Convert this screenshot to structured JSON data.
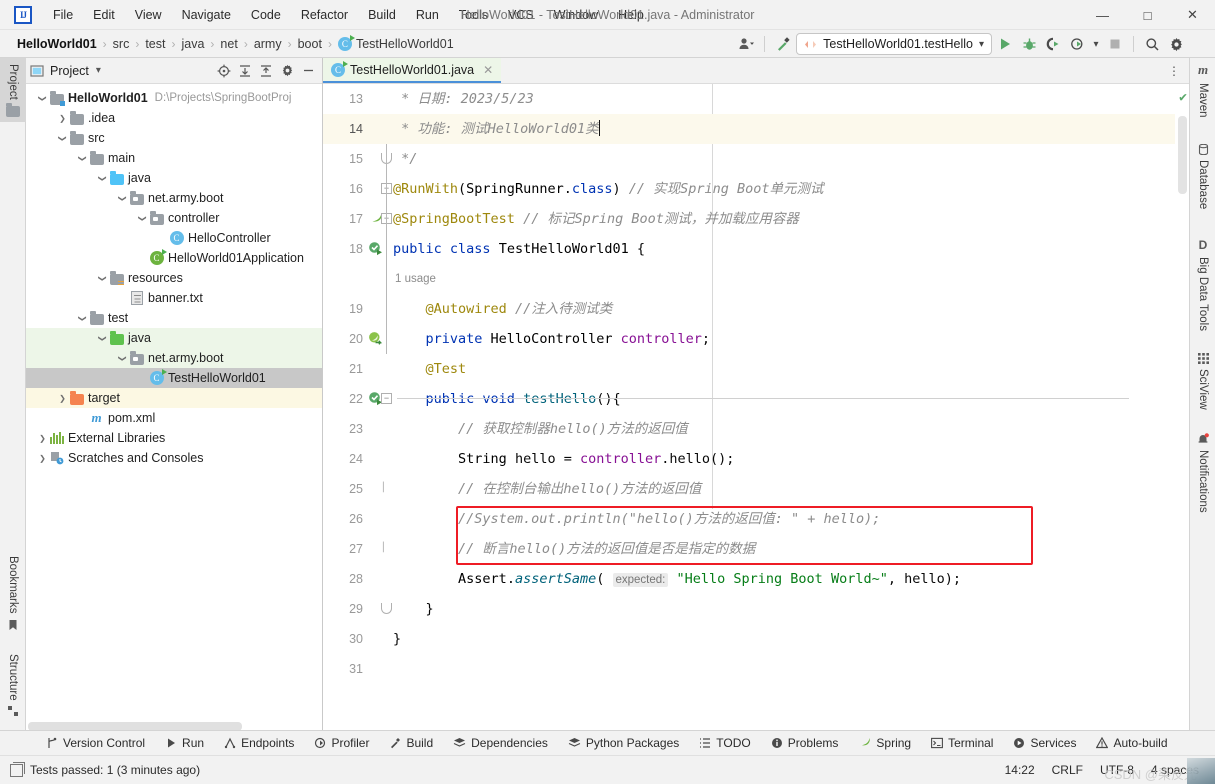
{
  "window": {
    "title": "HelloWorld01 - TestHelloWorld01.java - Administrator",
    "minimize": "—",
    "maximize": "□",
    "close": "✕",
    "logo": "IJ"
  },
  "menubar": {
    "items": [
      "File",
      "Edit",
      "View",
      "Navigate",
      "Code",
      "Refactor",
      "Build",
      "Run",
      "Tools",
      "VCS",
      "Window",
      "Help"
    ]
  },
  "breadcrumb": {
    "items": [
      "HelloWorld01",
      "src",
      "test",
      "java",
      "net",
      "army",
      "boot",
      "TestHelloWorld01"
    ],
    "separator": "›"
  },
  "toolbar": {
    "run_config": "TestHelloWorld01.testHello",
    "dropdown_caret": "▾",
    "icons": [
      "profile-icon",
      "build-hammer-icon",
      "run-icon",
      "debug-icon",
      "run-coverage-icon",
      "profile-run-icon",
      "stop-icon",
      "search-icon",
      "settings-icon",
      "ai-assistant-icon"
    ]
  },
  "left_tool_strip": {
    "tabs": [
      {
        "label": "Project",
        "icon": "folder-icon",
        "active": true
      },
      {
        "label": "Bookmarks",
        "icon": "bookmark-icon",
        "active": false
      },
      {
        "label": "Structure",
        "icon": "structure-icon",
        "active": false
      }
    ]
  },
  "right_tool_strip": {
    "tabs": [
      {
        "label": "Maven",
        "icon": "maven-icon"
      },
      {
        "label": "Database",
        "icon": "database-icon"
      },
      {
        "label": "Big Data Tools",
        "icon": "bigdata-icon"
      },
      {
        "label": "SciView",
        "icon": "sciview-icon"
      },
      {
        "label": "Notifications",
        "icon": "bell-icon"
      }
    ]
  },
  "project_panel": {
    "title": "Project",
    "title_caret": "▾",
    "header_icons": [
      "locate-icon",
      "expand-all-icon",
      "collapse-all-icon",
      "settings-icon",
      "hide-icon"
    ],
    "tree": [
      {
        "depth": 0,
        "arrow": "down",
        "icon": "module-folder-icon",
        "label": "HelloWorld01",
        "bold": true,
        "path": "D:\\Projects\\SpringBootProj",
        "state": "normal"
      },
      {
        "depth": 1,
        "arrow": "right",
        "icon": "folder-icon",
        "label": ".idea",
        "bold": false,
        "path": "",
        "state": "normal"
      },
      {
        "depth": 1,
        "arrow": "down",
        "icon": "folder-icon",
        "label": "src",
        "bold": false,
        "path": "",
        "state": "normal"
      },
      {
        "depth": 2,
        "arrow": "down",
        "icon": "folder-icon",
        "label": "main",
        "bold": false,
        "path": "",
        "state": "normal"
      },
      {
        "depth": 3,
        "arrow": "down",
        "icon": "source-folder-icon",
        "label": "java",
        "bold": false,
        "path": "",
        "state": "normal"
      },
      {
        "depth": 4,
        "arrow": "down",
        "icon": "package-icon",
        "label": "net.army.boot",
        "bold": false,
        "path": "",
        "state": "normal"
      },
      {
        "depth": 5,
        "arrow": "down",
        "icon": "package-icon",
        "label": "controller",
        "bold": false,
        "path": "",
        "state": "normal"
      },
      {
        "depth": 6,
        "arrow": "none",
        "icon": "java-class-icon",
        "label": "HelloController",
        "bold": false,
        "path": "",
        "state": "normal"
      },
      {
        "depth": 5,
        "arrow": "none",
        "icon": "spring-class-icon",
        "label": "HelloWorld01Application",
        "bold": false,
        "path": "",
        "state": "normal"
      },
      {
        "depth": 3,
        "arrow": "down",
        "icon": "resources-folder-icon",
        "label": "resources",
        "bold": false,
        "path": "",
        "state": "normal"
      },
      {
        "depth": 4,
        "arrow": "none",
        "icon": "text-file-icon",
        "label": "banner.txt",
        "bold": false,
        "path": "",
        "state": "normal"
      },
      {
        "depth": 2,
        "arrow": "down",
        "icon": "folder-icon",
        "label": "test",
        "bold": false,
        "path": "",
        "state": "normal"
      },
      {
        "depth": 3,
        "arrow": "down",
        "icon": "test-source-folder-icon",
        "label": "java",
        "bold": false,
        "path": "",
        "state": "green"
      },
      {
        "depth": 4,
        "arrow": "down",
        "icon": "package-icon",
        "label": "net.army.boot",
        "bold": false,
        "path": "",
        "state": "green"
      },
      {
        "depth": 5,
        "arrow": "none",
        "icon": "java-test-class-icon",
        "label": "TestHelloWorld01",
        "bold": false,
        "path": "",
        "state": "selected"
      },
      {
        "depth": 1,
        "arrow": "right",
        "icon": "target-folder-icon",
        "label": "target",
        "bold": false,
        "path": "",
        "state": "yellow"
      },
      {
        "depth": 2,
        "arrow": "none",
        "icon": "maven-file-icon",
        "label": "pom.xml",
        "bold": false,
        "path": "",
        "state": "normal"
      },
      {
        "depth": 0,
        "arrow": "right",
        "icon": "libraries-icon",
        "label": "External Libraries",
        "bold": false,
        "path": "",
        "state": "normal"
      },
      {
        "depth": 0,
        "arrow": "right",
        "icon": "scratches-icon",
        "label": "Scratches and Consoles",
        "bold": false,
        "path": "",
        "state": "normal"
      }
    ]
  },
  "editor": {
    "tab": {
      "label": "TestHelloWorld01.java",
      "icon": "java-test-class-icon",
      "close": "✕"
    },
    "more_icon": "⋮",
    "inspection_status": "✔",
    "first_line_number": 13,
    "lines": [
      {
        "num": "13",
        "gutter_icon": "",
        "fold": "",
        "parts": [
          {
            "t": " * ",
            "c": "cmt"
          },
          {
            "t": "日期: 2023/5/23",
            "c": "cmt"
          }
        ]
      },
      {
        "num": "14",
        "gutter_icon": "",
        "fold": "",
        "current": true,
        "parts": [
          {
            "t": " * ",
            "c": "cmt"
          },
          {
            "t": "功能: 测试HelloWorld01类",
            "c": "cmt"
          },
          {
            "t": "|caret|",
            "c": "caret"
          }
        ]
      },
      {
        "num": "15",
        "gutter_icon": "",
        "fold": "end",
        "parts": [
          {
            "t": " */",
            "c": "cmt"
          }
        ]
      },
      {
        "num": "16",
        "gutter_icon": "",
        "fold": "start",
        "parts": [
          {
            "t": "@RunWith",
            "c": "ann"
          },
          {
            "t": "(",
            "c": "plain"
          },
          {
            "t": "SpringRunner",
            "c": "cls-n"
          },
          {
            "t": ".",
            "c": "plain"
          },
          {
            "t": "class",
            "c": "kw"
          },
          {
            "t": ") ",
            "c": "plain"
          },
          {
            "t": "// 实现Spring Boot单元测试",
            "c": "cmt"
          }
        ]
      },
      {
        "num": "17",
        "gutter_icon": "spring-leaf",
        "fold": "start",
        "parts": [
          {
            "t": "@SpringBootTest",
            "c": "ann"
          },
          {
            "t": " ",
            "c": "plain"
          },
          {
            "t": "// 标记Spring Boot测试，并加载应用容器",
            "c": "cmt"
          }
        ]
      },
      {
        "num": "18",
        "gutter_icon": "run-test",
        "fold": "",
        "parts": [
          {
            "t": "public ",
            "c": "kw"
          },
          {
            "t": "class ",
            "c": "kw"
          },
          {
            "t": "TestHelloWorld01 ",
            "c": "cls-n"
          },
          {
            "t": "{",
            "c": "plain"
          }
        ]
      },
      {
        "num": "",
        "gutter_icon": "",
        "fold": "",
        "usage": "1 usage",
        "parts": []
      },
      {
        "num": "19",
        "gutter_icon": "",
        "fold": "",
        "parts": [
          {
            "t": "    ",
            "c": "plain"
          },
          {
            "t": "@Autowired",
            "c": "ann"
          },
          {
            "t": " ",
            "c": "plain"
          },
          {
            "t": "//注入待测试类",
            "c": "cmt"
          }
        ]
      },
      {
        "num": "20",
        "gutter_icon": "inject-bean",
        "fold": "",
        "parts": [
          {
            "t": "    ",
            "c": "plain"
          },
          {
            "t": "private ",
            "c": "kw"
          },
          {
            "t": "HelloController ",
            "c": "cls-n"
          },
          {
            "t": "controller",
            "c": "fld"
          },
          {
            "t": ";",
            "c": "plain"
          }
        ]
      },
      {
        "num": "21",
        "gutter_icon": "",
        "fold": "",
        "parts": [
          {
            "t": "    ",
            "c": "plain"
          },
          {
            "t": "@Test",
            "c": "ann"
          }
        ]
      },
      {
        "num": "22",
        "gutter_icon": "run-test",
        "fold": "start",
        "parts": [
          {
            "t": "    ",
            "c": "plain"
          },
          {
            "t": "public ",
            "c": "kw"
          },
          {
            "t": "void ",
            "c": "kw"
          },
          {
            "t": "testHello",
            "c": "mth"
          },
          {
            "t": "(){",
            "c": "plain"
          }
        ]
      },
      {
        "num": "23",
        "gutter_icon": "",
        "fold": "",
        "parts": [
          {
            "t": "        ",
            "c": "plain"
          },
          {
            "t": "// 获取控制器hello()方法的返回值",
            "c": "cmt"
          }
        ]
      },
      {
        "num": "24",
        "gutter_icon": "",
        "fold": "",
        "parts": [
          {
            "t": "        ",
            "c": "plain"
          },
          {
            "t": "String ",
            "c": "cls-n"
          },
          {
            "t": "hello ",
            "c": "plain"
          },
          {
            "t": "= ",
            "c": "plain"
          },
          {
            "t": "controller",
            "c": "fld"
          },
          {
            "t": ".",
            "c": "plain"
          },
          {
            "t": "hello",
            "c": "plain"
          },
          {
            "t": "();",
            "c": "plain"
          }
        ]
      },
      {
        "num": "25",
        "gutter_icon": "",
        "fold": "mid",
        "parts": [
          {
            "t": "        ",
            "c": "plain"
          },
          {
            "t": "// 在控制台输出hello()方法的返回值",
            "c": "cmt"
          }
        ]
      },
      {
        "num": "26",
        "gutter_icon": "",
        "fold": "",
        "parts": [
          {
            "t": "        ",
            "c": "plain"
          },
          {
            "t": "//System.out.println(\"hello()方法的返回值: \" + hello);",
            "c": "cmt"
          }
        ]
      },
      {
        "num": "27",
        "gutter_icon": "",
        "fold": "mid",
        "parts": [
          {
            "t": "        ",
            "c": "plain"
          },
          {
            "t": "// 断言hello()方法的返回值是否是指定的数据",
            "c": "cmt"
          }
        ]
      },
      {
        "num": "28",
        "gutter_icon": "",
        "fold": "",
        "parts": [
          {
            "t": "        ",
            "c": "plain"
          },
          {
            "t": "Assert",
            "c": "cls-n"
          },
          {
            "t": ".",
            "c": "plain"
          },
          {
            "t": "assertSame",
            "c": "mth-i"
          },
          {
            "t": "( ",
            "c": "plain"
          },
          {
            "t": "expected:",
            "c": "hint"
          },
          {
            "t": " ",
            "c": "plain"
          },
          {
            "t": "\"Hello Spring Boot World~\"",
            "c": "str"
          },
          {
            "t": ", hello);",
            "c": "plain"
          }
        ]
      },
      {
        "num": "29",
        "gutter_icon": "",
        "fold": "end",
        "parts": [
          {
            "t": "    }",
            "c": "plain"
          }
        ]
      },
      {
        "num": "30",
        "gutter_icon": "",
        "fold": "",
        "parts": [
          {
            "t": "}",
            "c": "plain"
          }
        ]
      },
      {
        "num": "31",
        "gutter_icon": "",
        "fold": "",
        "parts": []
      }
    ]
  },
  "bottom_tabs": [
    {
      "label": "Version Control",
      "icon": "branch-icon"
    },
    {
      "label": "Run",
      "icon": "run-icon"
    },
    {
      "label": "Endpoints",
      "icon": "endpoints-icon"
    },
    {
      "label": "Profiler",
      "icon": "profiler-icon"
    },
    {
      "label": "Build",
      "icon": "hammer-icon"
    },
    {
      "label": "Dependencies",
      "icon": "layers-icon"
    },
    {
      "label": "Python Packages",
      "icon": "layers-icon"
    },
    {
      "label": "TODO",
      "icon": "list-icon"
    },
    {
      "label": "Problems",
      "icon": "info-icon"
    },
    {
      "label": "Spring",
      "icon": "leaf-icon"
    },
    {
      "label": "Terminal",
      "icon": "terminal-icon"
    },
    {
      "label": "Services",
      "icon": "play-circle-icon"
    },
    {
      "label": "Auto-build",
      "icon": "warning-icon"
    }
  ],
  "statusbar": {
    "message": "Tests passed: 1 (3 minutes ago)",
    "time": "14:22",
    "line_separator": "CRLF",
    "encoding": "UTF-8",
    "indent": "4 spaces",
    "watermark": "CSDN @染反光"
  },
  "colors": {
    "accent_blue": "#4a90d9",
    "keyword": "#0033b3",
    "annotation": "#9e880d",
    "comment": "#8c8c8c",
    "string": "#067d17",
    "field": "#871094",
    "highlight_red": "#ee1c25",
    "test_green": "#edf6e8",
    "selection_gray": "#c8c8c8"
  }
}
